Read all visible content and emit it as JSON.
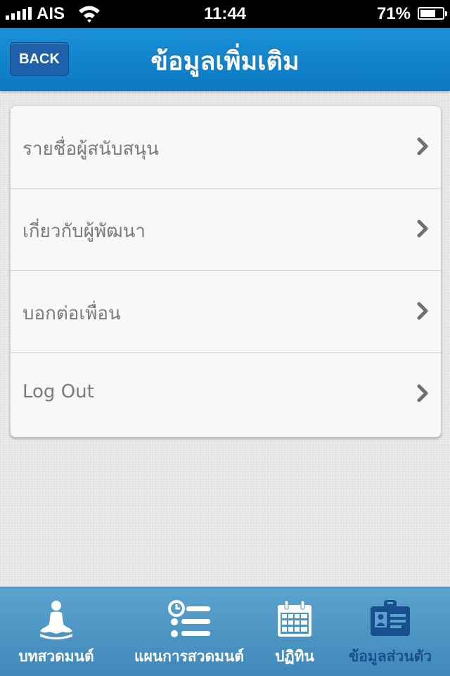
{
  "status_bar": {
    "carrier": "AIS",
    "time": "11:44",
    "battery": "71%",
    "battery_level": 0.71
  },
  "nav": {
    "back_label": "BACK",
    "title": "ข้อมูลเพิ่มเติม"
  },
  "menu": {
    "items": [
      {
        "label": "รายชื่อผู้สนับสนุน"
      },
      {
        "label": "เกี่ยวกับผู้พัฒนา"
      },
      {
        "label": "บอกต่อเพื่อน"
      },
      {
        "label": "Log Out"
      }
    ]
  },
  "tabs": {
    "items": [
      {
        "label": "บทสวดมนต์",
        "icon": "meditation-icon"
      },
      {
        "label": "แผนการสวดมนต์",
        "icon": "schedule-list-icon"
      },
      {
        "label": "ปฏิทิน",
        "icon": "calendar-icon"
      },
      {
        "label": "ข้อมูลส่วนตัว",
        "icon": "id-card-icon"
      }
    ],
    "active_index": 3,
    "active_color": "#1a4f8f"
  },
  "colors": {
    "nav_blue": "#0b78c2",
    "tab_blue": "#4a94c4",
    "back_button": "#1e61a8"
  }
}
